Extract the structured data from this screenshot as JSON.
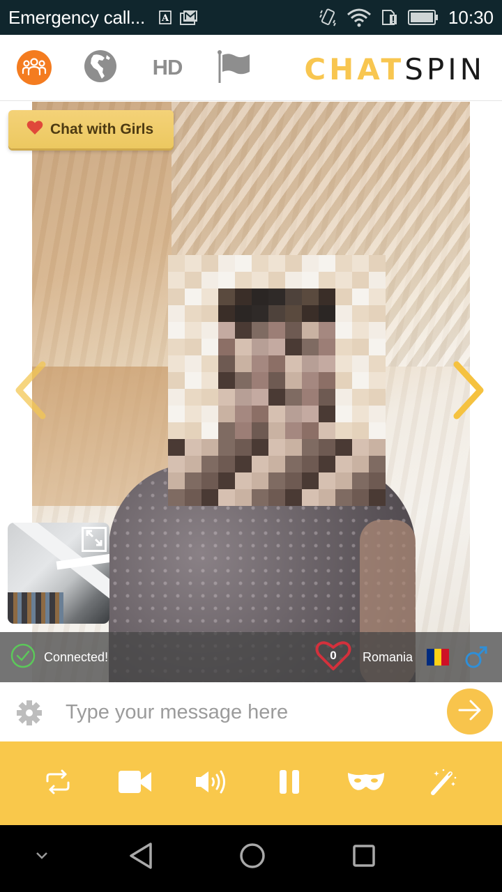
{
  "status_bar": {
    "carrier_text": "Emergency call...",
    "notifications": [
      "font-a-icon",
      "gmail-icon"
    ],
    "system_icons": [
      "vibrate-icon",
      "wifi-icon",
      "sim-alert-icon",
      "battery-icon"
    ],
    "time": "10:30"
  },
  "top_nav": {
    "items": [
      {
        "name": "people",
        "icon": "people-icon",
        "active": true
      },
      {
        "name": "globe",
        "icon": "globe-icon",
        "active": false
      },
      {
        "name": "hd",
        "label": "HD",
        "active": false
      },
      {
        "name": "report",
        "icon": "flag-icon",
        "active": false
      }
    ],
    "logo_part1": "CHAT",
    "logo_part2": "SPIN"
  },
  "video": {
    "chat_with_girls_label": "Chat with Girls",
    "prev_icon": "chevron-left-icon",
    "next_icon": "chevron-right-icon",
    "self_view_expand_icon": "expand-icon"
  },
  "info_bar": {
    "status": "Connected!",
    "likes_count": "0",
    "country": "Romania",
    "flag_colors": [
      "#002b7f",
      "#fcd116",
      "#ce1126"
    ],
    "gender_icon": "male-icon"
  },
  "message_bar": {
    "placeholder": "Type your message here",
    "value": "",
    "settings_icon": "gear-icon",
    "send_icon": "arrow-right-icon"
  },
  "toolbar": {
    "buttons": [
      {
        "name": "switch-camera",
        "icon": "repeat-icon"
      },
      {
        "name": "video",
        "icon": "video-camera-icon"
      },
      {
        "name": "sound",
        "icon": "speaker-icon"
      },
      {
        "name": "pause",
        "icon": "pause-icon"
      },
      {
        "name": "mask",
        "icon": "mask-icon"
      },
      {
        "name": "effects",
        "icon": "magic-wand-icon"
      }
    ]
  },
  "colors": {
    "brand_yellow": "#f9c84b",
    "active_orange": "#f47c20",
    "status_bar_bg": "#10262d",
    "connected_green": "#5cc85a",
    "heart_red": "#d3313c",
    "male_blue": "#2f8fd8"
  }
}
